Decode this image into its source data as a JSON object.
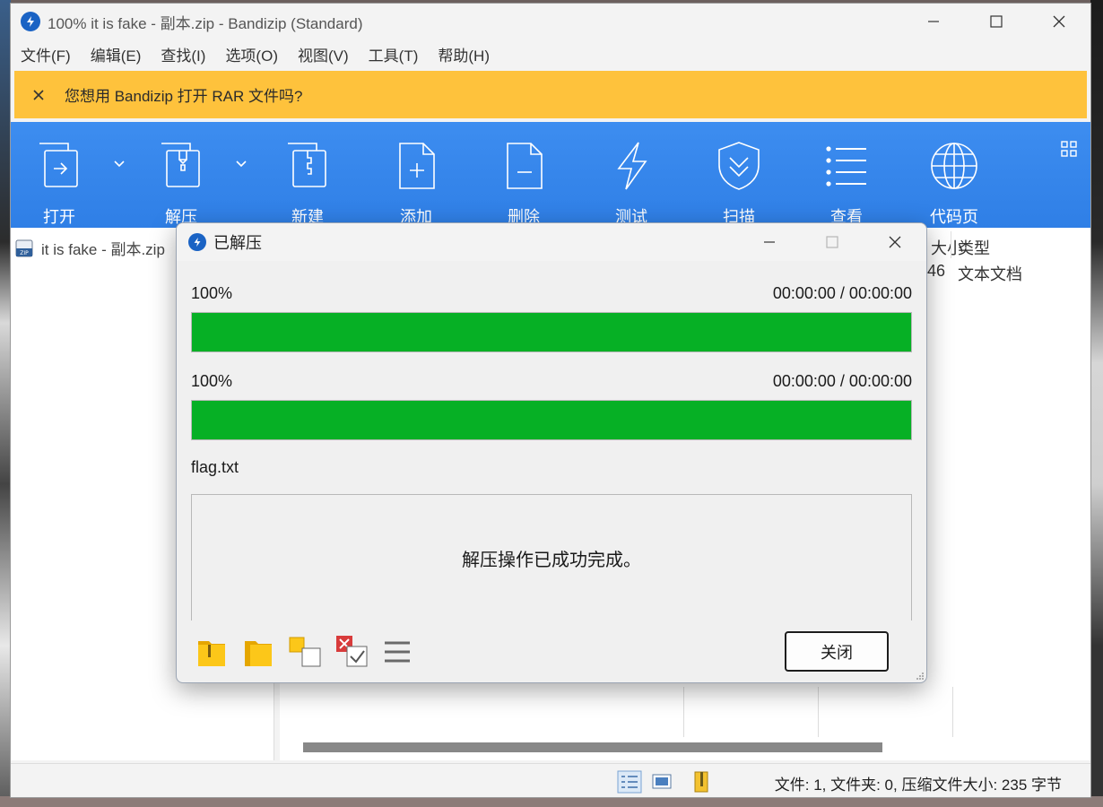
{
  "window": {
    "title": "100% it is fake - 副本.zip - Bandizip (Standard)"
  },
  "menu": [
    "文件(F)",
    "编辑(E)",
    "查找(I)",
    "选项(O)",
    "视图(V)",
    "工具(T)",
    "帮助(H)"
  ],
  "notice": {
    "text": "您想用 Bandizip 打开 RAR 文件吗?",
    "color": "#fec23c"
  },
  "toolbar": {
    "open": "打开",
    "extract": "解压",
    "new": "新建",
    "add": "添加",
    "delete": "删除",
    "test": "测试",
    "scan": "扫描",
    "view": "查看",
    "codepage": "代码页",
    "color": "#3a89ee"
  },
  "tree": {
    "archive": "it is fake - 副本.zip"
  },
  "file_list": {
    "headers": {
      "size_partial": "大小",
      "type": "类型"
    },
    "rows": [
      {
        "size_partial": "46",
        "type": "文本文档"
      }
    ]
  },
  "status": {
    "text": "文件: 1, 文件夹: 0, 压缩文件大小: 235 字节"
  },
  "dialog": {
    "title": "已解压",
    "progress1": {
      "percent_text": "100%",
      "time": "00:00:00 / 00:00:00",
      "fraction": 1.0
    },
    "progress2": {
      "percent_text": "100%",
      "time": "00:00:00 / 00:00:00",
      "fraction": 1.0
    },
    "current_file": "flag.txt",
    "message": "解压操作已成功完成。",
    "close_label": "关闭",
    "bar_color": "#06b025"
  }
}
